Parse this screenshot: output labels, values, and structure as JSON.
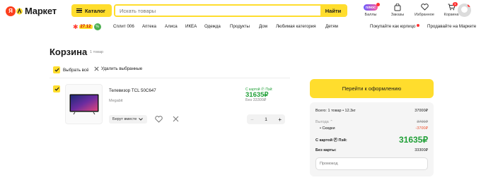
{
  "header": {
    "logo_badge": "Я",
    "logo_text": "Маркет",
    "catalog_label": "Каталог",
    "search_placeholder": "Искать товары",
    "search_button": "Найти",
    "icons": [
      {
        "label": "Баллы",
        "icon": "plus-badge-icon",
        "badge_text": "ПЛЮС"
      },
      {
        "label": "Заказы",
        "icon": "orders-icon"
      },
      {
        "label": "Избранное",
        "icon": "heart-icon"
      },
      {
        "label": "Корзина",
        "icon": "cart-icon",
        "count": "1"
      }
    ]
  },
  "nav": {
    "promo_date": "27.12",
    "promo_badge": "%",
    "items": [
      "Сплит 006",
      "Аптека",
      "Алиса",
      "ИКЕА",
      "Одежда",
      "Продукты",
      "Дом",
      "Любимая категория",
      "Детям"
    ],
    "right_items": [
      "Покупайте как юрлицо",
      "Продавайте на Маркете"
    ]
  },
  "cart": {
    "title": "Корзина",
    "count": "1 товар",
    "select_all": "Выбрать всё",
    "delete_selected": "Удалить выбранные",
    "item": {
      "name": "Телевизор TCL 50C647",
      "seller": "Megabit",
      "together": "Берут вместе",
      "price_card_label": "С картой Ⓟ Пэй:",
      "price_card": "31635₽",
      "price_nocard": "Без 33300₽",
      "qty": "1",
      "minus": "−",
      "plus": "+"
    }
  },
  "summary": {
    "checkout": "Перейти к оформлению",
    "total_label": "Всего: 1 товар • 12.3кг",
    "total_value": "37000₽",
    "benefit_label": "Выгода ⌃",
    "benefit_value": "3700₽",
    "discount_label": "• Скидки",
    "discount_value": "-3700₽",
    "card_label": "С картой Ⓟ Пэй:",
    "card_value": "31635₽",
    "nocard_label": "Без карты:",
    "nocard_value": "33300₽",
    "promo_placeholder": "Промокод"
  },
  "colors": {
    "accent": "#ffdd2d",
    "green": "#21a038",
    "red": "#ff3b30"
  }
}
